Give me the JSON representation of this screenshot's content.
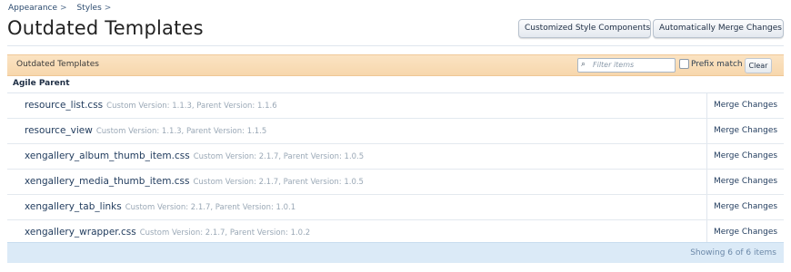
{
  "breadcrumb": [
    "Appearance",
    "Styles"
  ],
  "breadcrumb_sep": ">",
  "page": {
    "title": "Outdated Templates"
  },
  "top_buttons": {
    "customized": "Customized Style Components",
    "merge_all": "Automatically Merge Changes"
  },
  "filter": {
    "section_title": "Outdated Templates",
    "placeholder": "Filter items",
    "prefix_label": "Prefix match",
    "clear_label": "Clear"
  },
  "group": {
    "name": "Agile Parent"
  },
  "rows": [
    {
      "name": "resource_list.css",
      "meta": "Custom Version: 1.1.3, Parent Version: 1.1.6",
      "action": "Merge Changes"
    },
    {
      "name": "resource_view",
      "meta": "Custom Version: 1.1.3, Parent Version: 1.1.5",
      "action": "Merge Changes"
    },
    {
      "name": "xengallery_album_thumb_item.css",
      "meta": "Custom Version: 2.1.7, Parent Version: 1.0.5",
      "action": "Merge Changes"
    },
    {
      "name": "xengallery_media_thumb_item.css",
      "meta": "Custom Version: 2.1.7, Parent Version: 1.0.5",
      "action": "Merge Changes"
    },
    {
      "name": "xengallery_tab_links",
      "meta": "Custom Version: 2.1.7, Parent Version: 1.0.1",
      "action": "Merge Changes"
    },
    {
      "name": "xengallery_wrapper.css",
      "meta": "Custom Version: 2.1.7, Parent Version: 1.0.2",
      "action": "Merge Changes"
    }
  ],
  "footer": {
    "status": "Showing 6 of 6 items"
  },
  "icons": {
    "search": "search-icon",
    "prefix_checkbox": "checkbox"
  }
}
